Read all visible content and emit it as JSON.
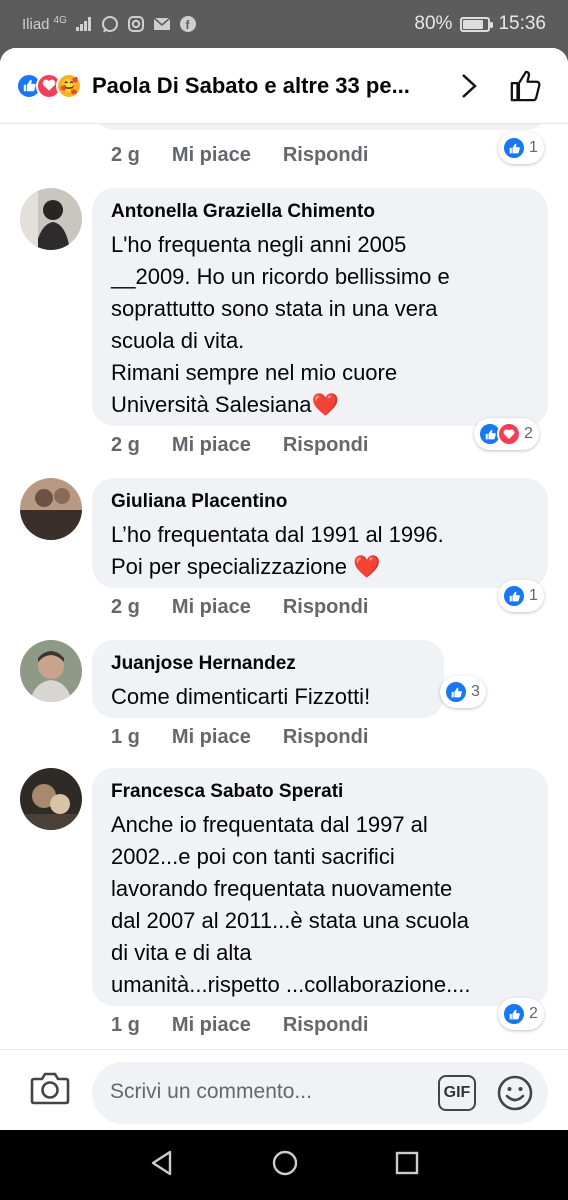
{
  "status_bar": {
    "carrier": "Iliad",
    "network": "4G",
    "battery": "80%",
    "battery_level": 0.8,
    "time": "15:36"
  },
  "header": {
    "title": "Paola Di Sabato e altre 33 pe...",
    "reaction_icons": [
      "like-icon",
      "love-icon",
      "care-icon"
    ]
  },
  "partial_comment": {
    "time": "2 g",
    "like_label": "Mi piace",
    "reply_label": "Rispondi",
    "reaction_count": "1"
  },
  "comments": [
    {
      "author": "Antonella Graziella Chimento",
      "text": "L'ho frequenta negli anni 2005\n__2009. Ho un ricordo bellissimo e\nsoprattutto sono stata in una vera\nscuola di vita.\nRimani sempre nel mio cuore\nUniversità Salesiana❤️",
      "time": "2 g",
      "like_label": "Mi piace",
      "reply_label": "Rispondi",
      "reactions": [
        "like",
        "love"
      ],
      "reaction_count": "2"
    },
    {
      "author": "Giuliana Placentino",
      "text": "L’ho frequentata dal 1991 al 1996.\nPoi per specializzazione ❤️",
      "time": "2 g",
      "like_label": "Mi piace",
      "reply_label": "Rispondi",
      "reactions": [
        "like"
      ],
      "reaction_count": "1"
    },
    {
      "author": "Juanjose Hernandez",
      "text": "Come dimenticarti Fizzotti!",
      "time": "1 g",
      "like_label": "Mi piace",
      "reply_label": "Rispondi",
      "reactions": [
        "like"
      ],
      "reaction_count": "3"
    },
    {
      "author": "Francesca Sabato Sperati",
      "text": "Anche io frequentata dal 1997 al\n2002...e poi con tanti sacrifici\nlavorando frequentata nuovamente\ndal 2007 al 2011...è stata una scuola\ndi vita e di alta\numanità...rispetto ...collaborazione....",
      "time": "1 g",
      "like_label": "Mi piace",
      "reply_label": "Rispondi",
      "reactions": [
        "like"
      ],
      "reaction_count": "2"
    }
  ],
  "composer": {
    "placeholder": "Scrivi un commento...",
    "gif_label": "GIF"
  },
  "colors": {
    "like_blue": "#1877f2",
    "love_red": "#f33e58",
    "bubble_bg": "#f0f2f5",
    "meta_gray": "#65676b"
  }
}
